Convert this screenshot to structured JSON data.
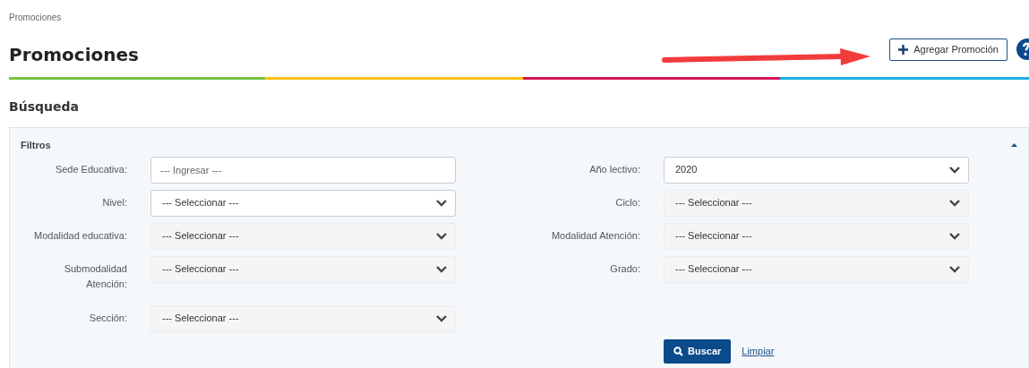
{
  "breadcrumb": "Promociones",
  "title": "Promociones",
  "add_button": {
    "label": "Agregar Promoción"
  },
  "section_title": "Búsqueda",
  "filters": {
    "title": "Filtros",
    "expanded": true,
    "left": [
      {
        "label": "Sede Educativa:",
        "kind": "text",
        "placeholder": "--- Ingresar ---",
        "disabled": false
      },
      {
        "label": "Nivel:",
        "kind": "select",
        "value": "--- Seleccionar ---",
        "disabled": false
      },
      {
        "label": "Modalidad educativa:",
        "kind": "select",
        "value": "--- Seleccionar ---",
        "disabled": true
      },
      {
        "label": "Submodalidad Atención:",
        "kind": "select",
        "value": "--- Seleccionar ---",
        "disabled": true
      },
      {
        "label": "Sección:",
        "kind": "select",
        "value": "--- Seleccionar ---",
        "disabled": true
      }
    ],
    "right": [
      {
        "label": "Año lectivo:",
        "kind": "select",
        "value": "2020",
        "disabled": false
      },
      {
        "label": "Ciclo:",
        "kind": "select",
        "value": "--- Seleccionar ---",
        "disabled": true
      },
      {
        "label": "Modalidad Atención:",
        "kind": "select",
        "value": "--- Seleccionar ---",
        "disabled": true
      },
      {
        "label": "Grado:",
        "kind": "select",
        "value": "--- Seleccionar ---",
        "disabled": true
      }
    ],
    "search_button": "Buscar",
    "clear_link": "Limpiar"
  }
}
